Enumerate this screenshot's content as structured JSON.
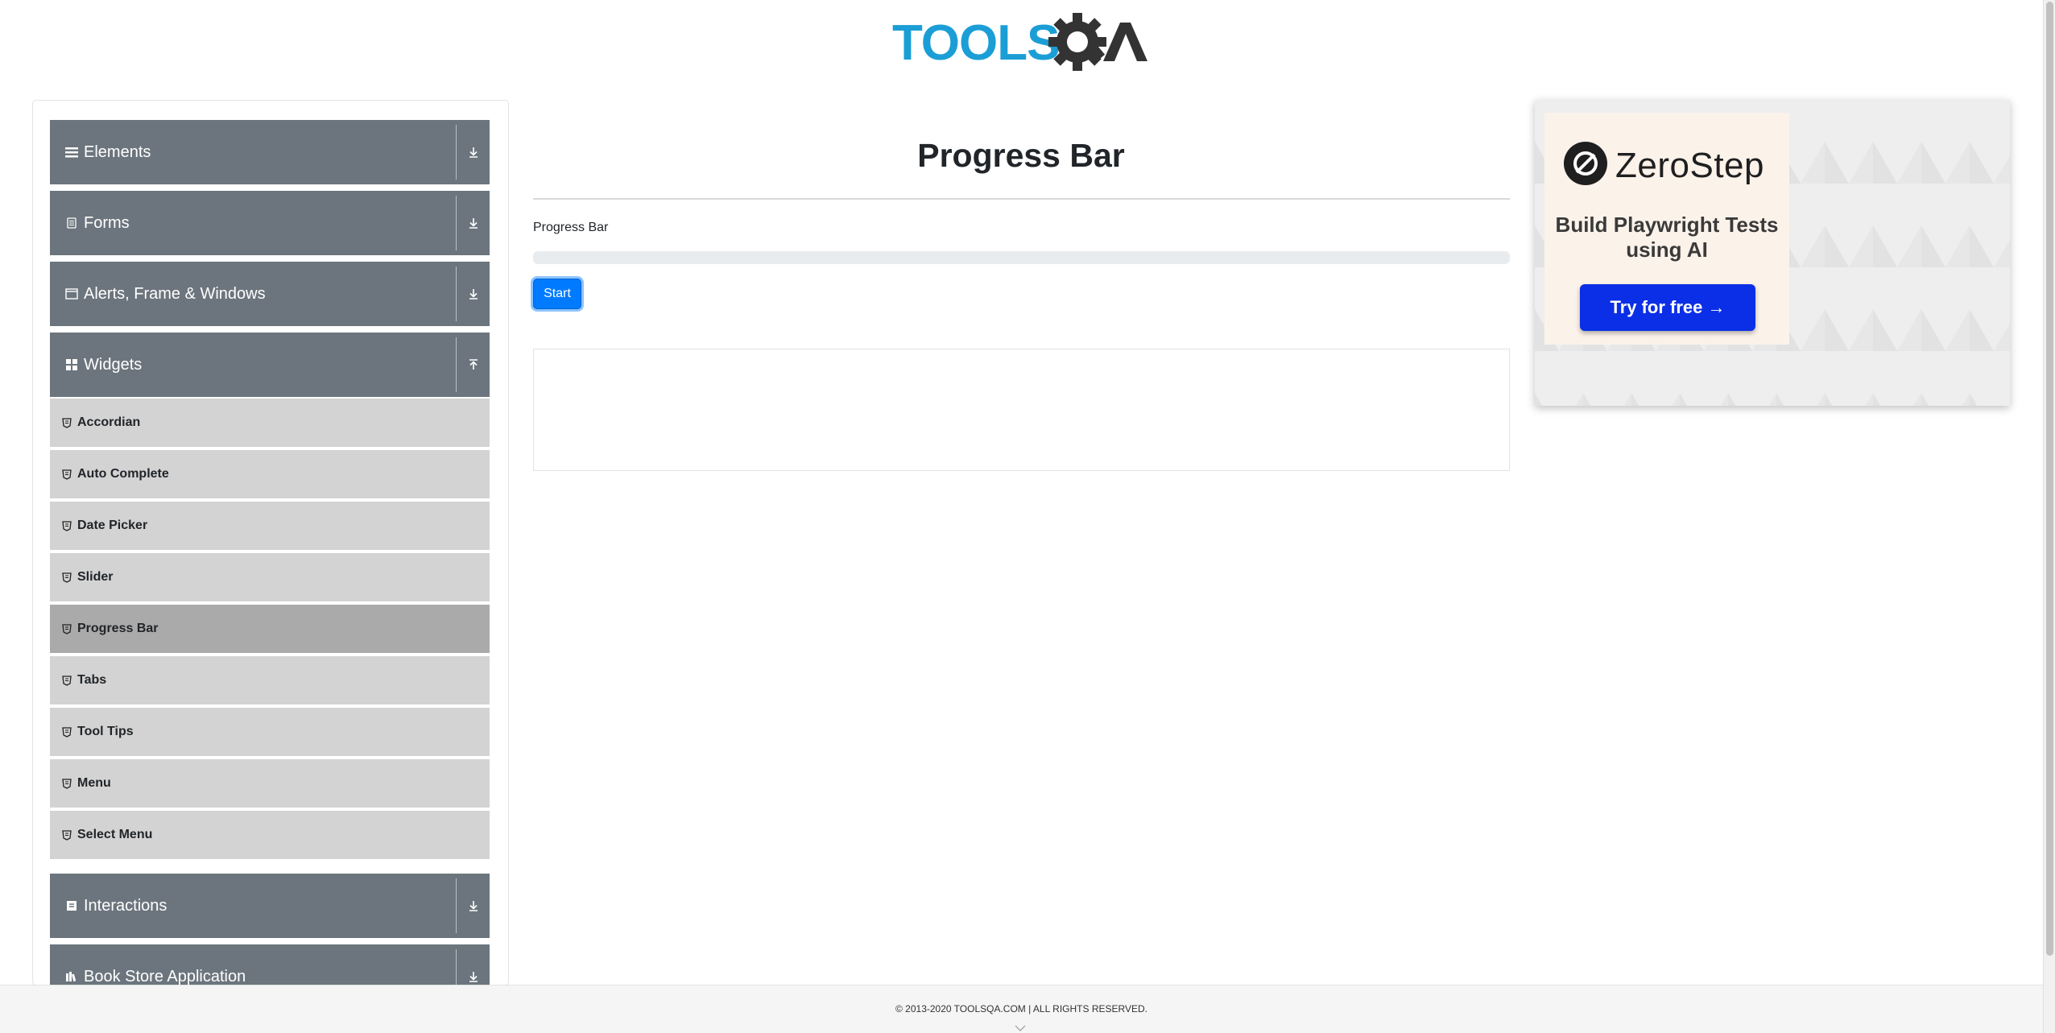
{
  "header": {
    "logo_text": "TOOLSQA"
  },
  "sidebar": {
    "groups": [
      {
        "label": "Elements",
        "icon": "menu-icon",
        "expanded": false
      },
      {
        "label": "Forms",
        "icon": "form-icon",
        "expanded": false
      },
      {
        "label": "Alerts, Frame & Windows",
        "icon": "window-icon",
        "expanded": false
      },
      {
        "label": "Widgets",
        "icon": "widgets-icon",
        "expanded": true
      },
      {
        "label": "Interactions",
        "icon": "interactions-icon",
        "expanded": false
      },
      {
        "label": "Book Store Application",
        "icon": "book-icon",
        "expanded": false
      }
    ],
    "widget_items": [
      {
        "label": "Accordian"
      },
      {
        "label": "Auto Complete"
      },
      {
        "label": "Date Picker"
      },
      {
        "label": "Slider"
      },
      {
        "label": "Progress Bar",
        "active": true
      },
      {
        "label": "Tabs"
      },
      {
        "label": "Tool Tips"
      },
      {
        "label": "Menu"
      },
      {
        "label": "Select Menu"
      }
    ]
  },
  "main": {
    "title": "Progress Bar",
    "progress_label": "Progress Bar",
    "progress_value": 0,
    "start_label": "Start"
  },
  "ad": {
    "brand": "ZeroStep",
    "headline": "Build Playwright Tests using AI",
    "cta": "Try for free →"
  },
  "footer": {
    "text": "© 2013-2020 TOOLSQA.COM | ALL RIGHTS RESERVED."
  },
  "colors": {
    "sidebar_group": "#6c757d",
    "sidebar_item": "#d3d3d3",
    "sidebar_item_active": "#aaaaaa",
    "primary": "#007bff",
    "logo_blue": "#1b9ed6",
    "ad_cta": "#0b2fe6"
  }
}
